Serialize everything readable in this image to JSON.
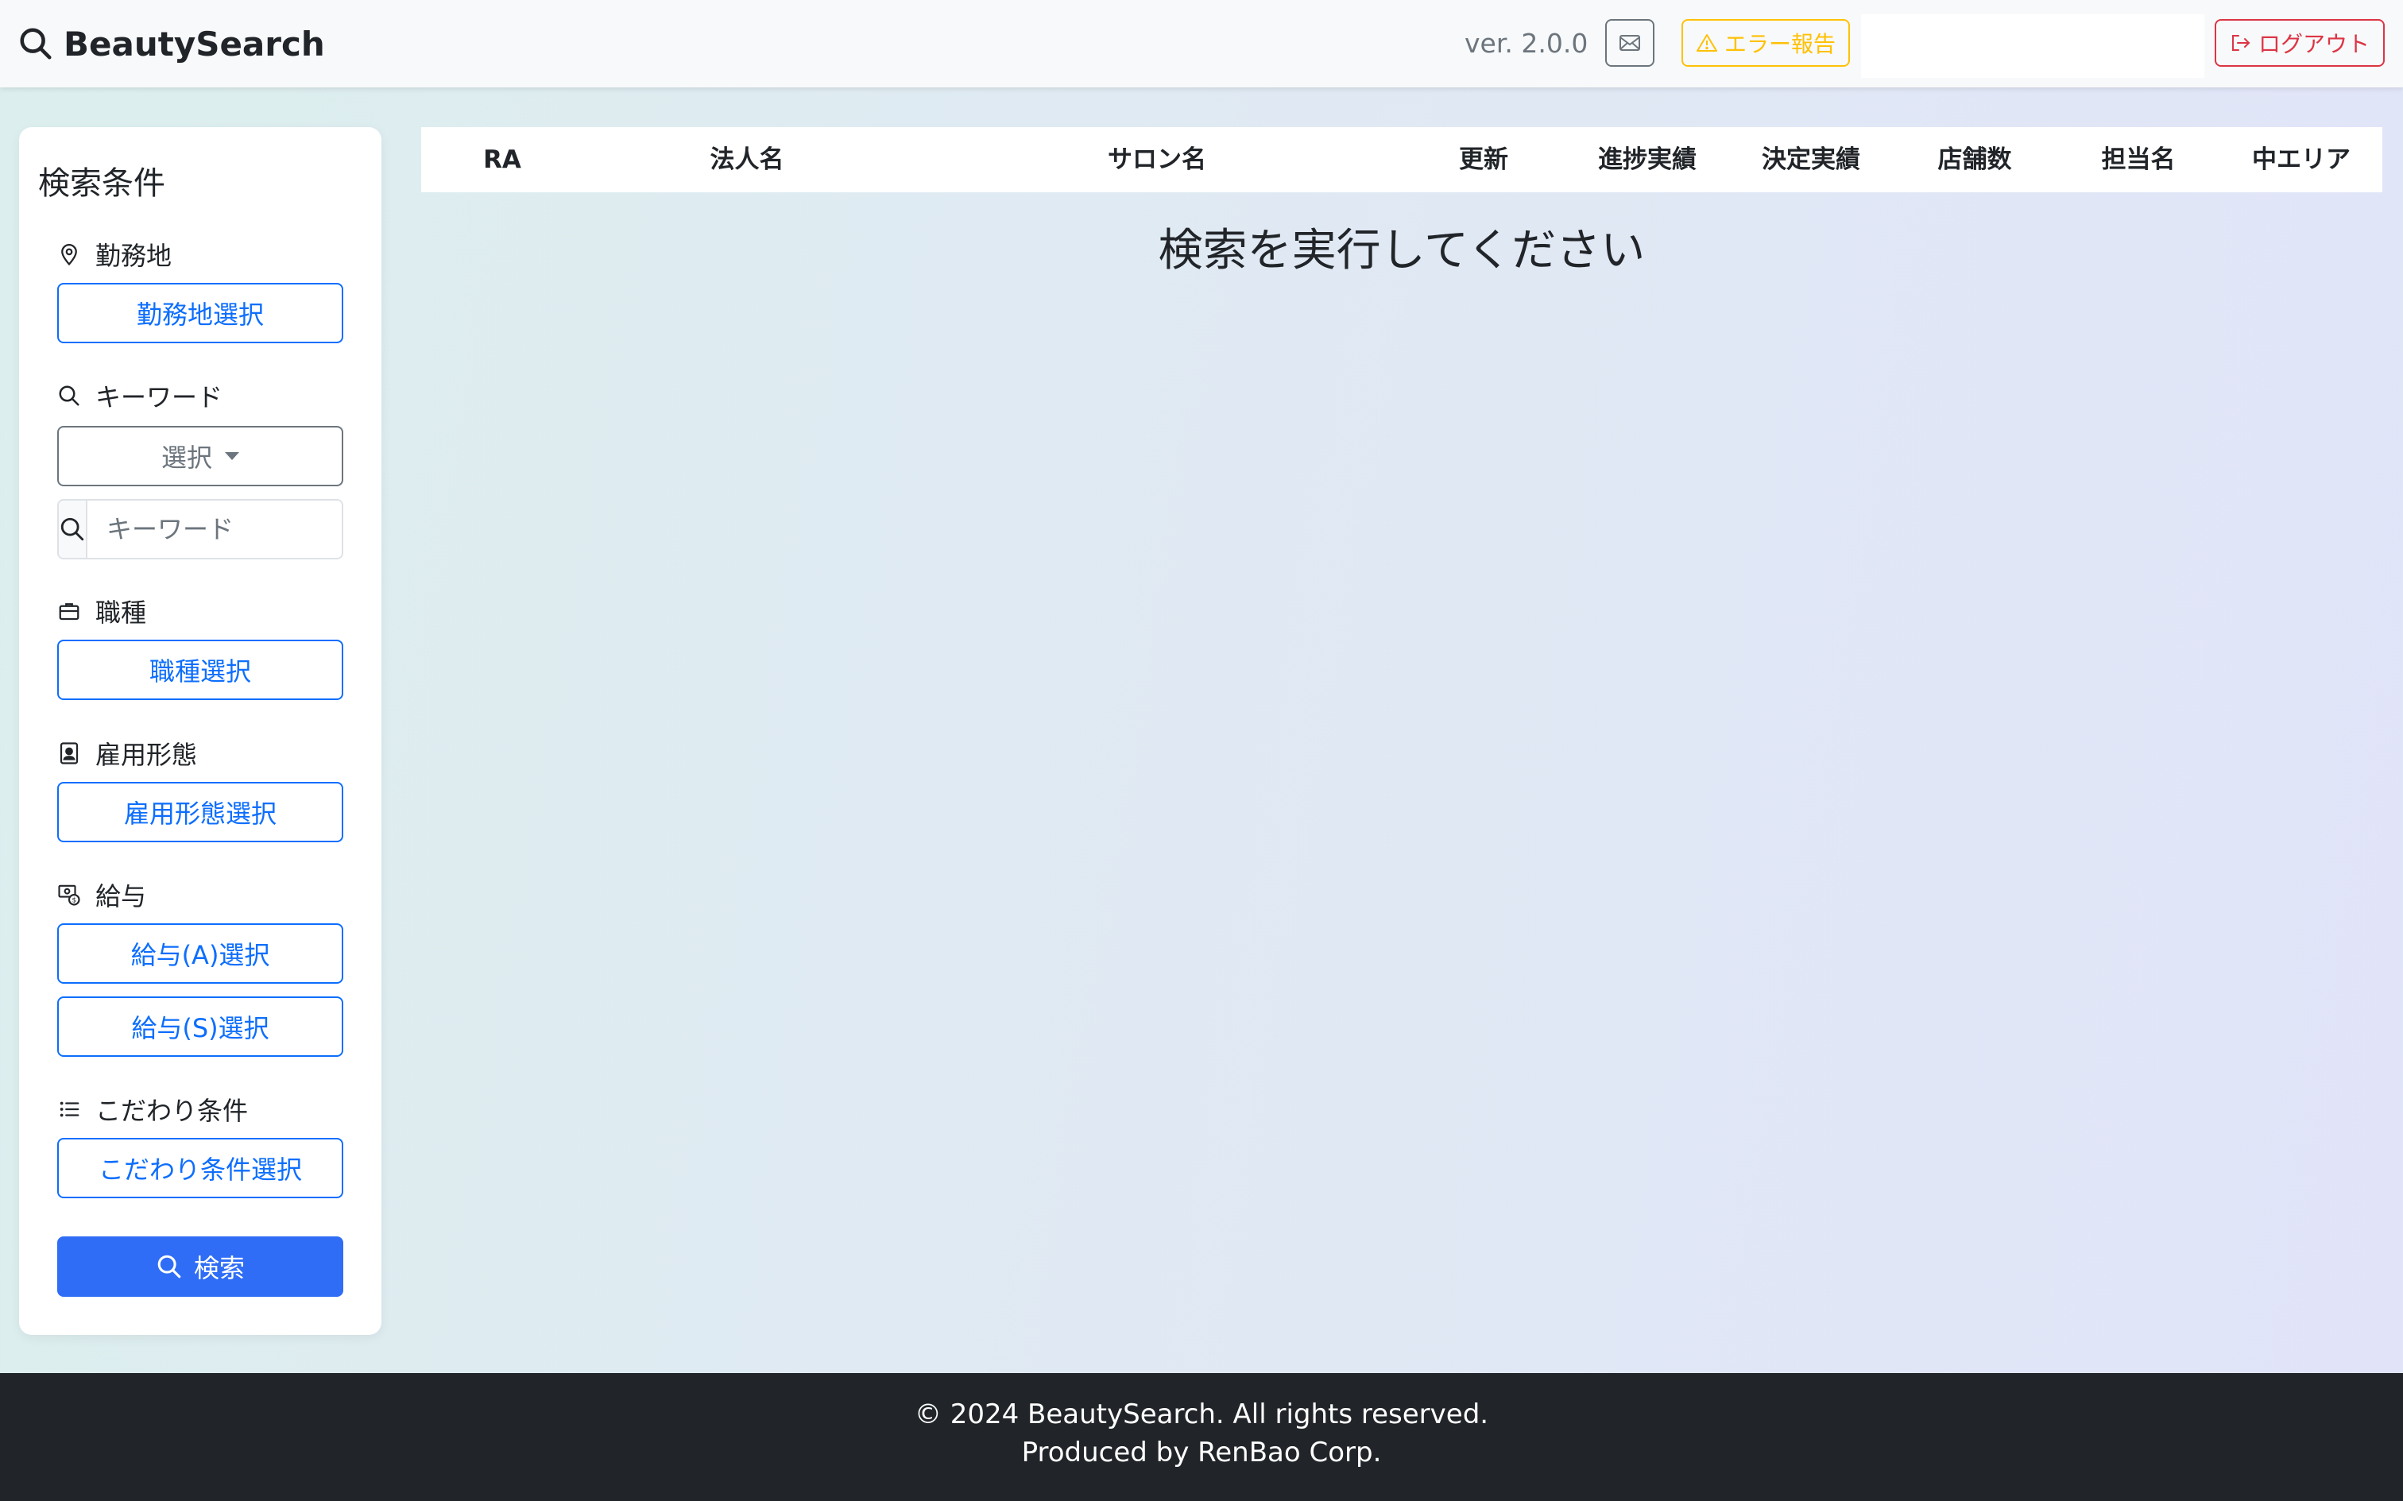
{
  "header": {
    "brand": "BeautySearch",
    "version": "ver. 2.0.0",
    "error_report_label": "エラー報告",
    "logout_label": "ログアウト"
  },
  "sidebar": {
    "title": "検索条件",
    "location": {
      "label": "勤務地",
      "button": "勤務地選択"
    },
    "keyword": {
      "label": "キーワード",
      "select_value": "選択",
      "input_placeholder": "キーワード"
    },
    "job_type": {
      "label": "職種",
      "button": "職種選択"
    },
    "employment": {
      "label": "雇用形態",
      "button": "雇用形態選択"
    },
    "salary": {
      "label": "給与",
      "button_a": "給与(A)選択",
      "button_s": "給与(S)選択"
    },
    "preferences": {
      "label": "こだわり条件",
      "button": "こだわり条件選択"
    },
    "search_button": "検索"
  },
  "results": {
    "columns": [
      "RA",
      "法人名",
      "サロン名",
      "更新",
      "進捗実績",
      "決定実績",
      "店舗数",
      "担当名",
      "中エリア"
    ],
    "empty_message": "検索を実行してください"
  },
  "footer": {
    "copyright": "© 2024 BeautySearch. All rights reserved.",
    "produced_by": "Produced by RenBao Corp."
  },
  "colors": {
    "primary": "#0d6efd",
    "warning": "#ffc107",
    "danger": "#dc3545",
    "footer_bg": "#212529"
  }
}
